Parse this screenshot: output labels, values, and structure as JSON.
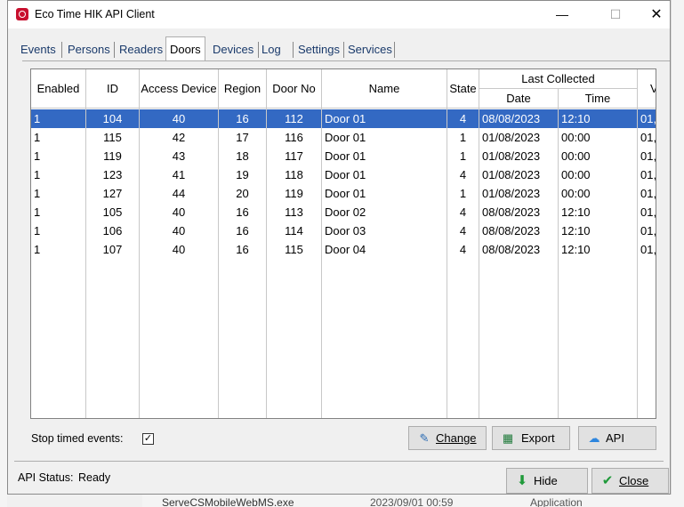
{
  "window": {
    "title": "Eco Time HIK API Client",
    "minimize": "—",
    "maximize": "☐",
    "close": "✕"
  },
  "tabs": [
    "Events",
    "Persons",
    "Readers",
    "Doors",
    "Devices",
    "Log",
    "Settings",
    "Services"
  ],
  "active_tab": "Doors",
  "table": {
    "headers": {
      "enabled": "Enabled",
      "id": "ID",
      "access_device": "Access Device",
      "region": "Region",
      "door_no": "Door No",
      "name": "Name",
      "state": "State",
      "last_collected": "Last Collected",
      "date": "Date",
      "time": "Time",
      "extra": "V"
    },
    "rows": [
      {
        "enabled": "1",
        "id": "104",
        "access_device": "40",
        "region": "16",
        "door_no": "112",
        "name": "Door 01",
        "state": "4",
        "date": "08/08/2023",
        "time": "12:10",
        "extra": "01,",
        "selected": true
      },
      {
        "enabled": "1",
        "id": "115",
        "access_device": "42",
        "region": "17",
        "door_no": "116",
        "name": "Door 01",
        "state": "1",
        "date": "01/08/2023",
        "time": "00:00",
        "extra": "01,"
      },
      {
        "enabled": "1",
        "id": "119",
        "access_device": "43",
        "region": "18",
        "door_no": "117",
        "name": "Door 01",
        "state": "1",
        "date": "01/08/2023",
        "time": "00:00",
        "extra": "01,"
      },
      {
        "enabled": "1",
        "id": "123",
        "access_device": "41",
        "region": "19",
        "door_no": "118",
        "name": "Door 01",
        "state": "4",
        "date": "01/08/2023",
        "time": "00:00",
        "extra": "01,"
      },
      {
        "enabled": "1",
        "id": "127",
        "access_device": "44",
        "region": "20",
        "door_no": "119",
        "name": "Door 01",
        "state": "1",
        "date": "01/08/2023",
        "time": "00:00",
        "extra": "01,"
      },
      {
        "enabled": "1",
        "id": "105",
        "access_device": "40",
        "region": "16",
        "door_no": "113",
        "name": "Door 02",
        "state": "4",
        "date": "08/08/2023",
        "time": "12:10",
        "extra": "01,"
      },
      {
        "enabled": "1",
        "id": "106",
        "access_device": "40",
        "region": "16",
        "door_no": "114",
        "name": "Door 03",
        "state": "4",
        "date": "08/08/2023",
        "time": "12:10",
        "extra": "01,"
      },
      {
        "enabled": "1",
        "id": "107",
        "access_device": "40",
        "region": "16",
        "door_no": "115",
        "name": "Door 04",
        "state": "4",
        "date": "08/08/2023",
        "time": "12:10",
        "extra": "01,"
      }
    ]
  },
  "options": {
    "stop_timed_events_label": "Stop timed events:",
    "stop_timed_events_checked": "✓"
  },
  "buttons": {
    "change": "Change",
    "export": "Export",
    "api": "API",
    "hide": "Hide",
    "close": "Close"
  },
  "status": {
    "label": "API Status:",
    "value": "Ready"
  },
  "background": {
    "file": "ServeCSMobileWebMS.exe",
    "date": "2023/09/01 00:59",
    "type": "Application"
  },
  "colors": {
    "selection": "#3369c3",
    "panel": "#f0f0f0",
    "brand": "#c8102e"
  }
}
